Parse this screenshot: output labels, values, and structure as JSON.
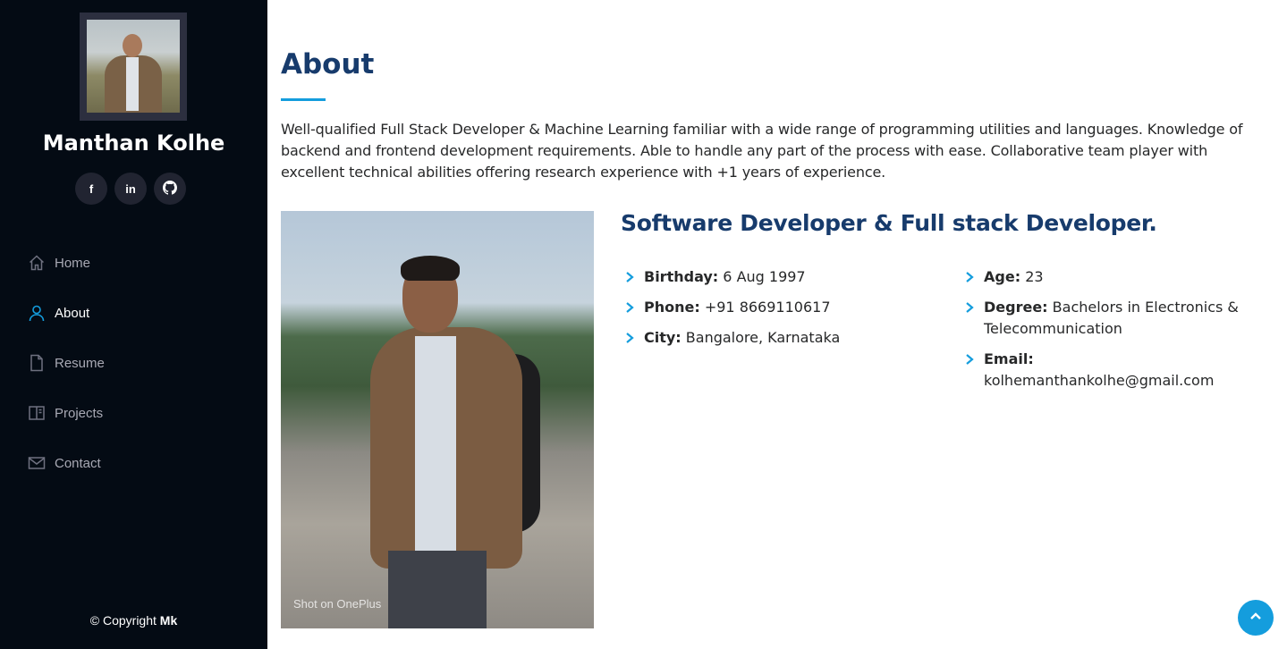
{
  "profile": {
    "name": "Manthan Kolhe",
    "social": [
      {
        "icon": "facebook-icon",
        "label": "f"
      },
      {
        "icon": "linkedin-icon",
        "label": "in"
      },
      {
        "icon": "github-icon",
        "label": ""
      }
    ]
  },
  "nav": {
    "items": [
      {
        "label": "Home",
        "icon": "home-icon",
        "active": false
      },
      {
        "label": "About",
        "icon": "person-icon",
        "active": true
      },
      {
        "label": "Resume",
        "icon": "file-icon",
        "active": false
      },
      {
        "label": "Projects",
        "icon": "book-icon",
        "active": false
      },
      {
        "label": "Contact",
        "icon": "envelope-icon",
        "active": false
      }
    ]
  },
  "footer": {
    "copyright_prefix": "© Copyright",
    "copyright_name": "Mk"
  },
  "about": {
    "title": "About",
    "intro": "Well-qualified Full Stack Developer & Machine Learning familiar with a wide range of programming utilities and languages. Knowledge of backend and frontend development requirements. Able to handle any part of the process with ease. Collaborative team player with excellent technical abilities offering research experience with +1 years of experience.",
    "photo_watermark": "Shot on OnePlus",
    "subtitle": "Software Developer & Full stack Developer.",
    "facts_left": [
      {
        "label": "Birthday:",
        "value": "6 Aug 1997"
      },
      {
        "label": "Phone:",
        "value": "+91 8669110617"
      },
      {
        "label": "City:",
        "value": "Bangalore, Karnataka"
      }
    ],
    "facts_right": [
      {
        "label": "Age:",
        "value": "23"
      },
      {
        "label": "Degree:",
        "value": "Bachelors in Electronics & Telecommunication"
      },
      {
        "label": "Email:",
        "value": "kolhemanthankolhe@gmail.com"
      }
    ]
  },
  "colors": {
    "sidebar_bg": "#040b14",
    "accent": "#149ddd",
    "heading": "#173b6c"
  }
}
